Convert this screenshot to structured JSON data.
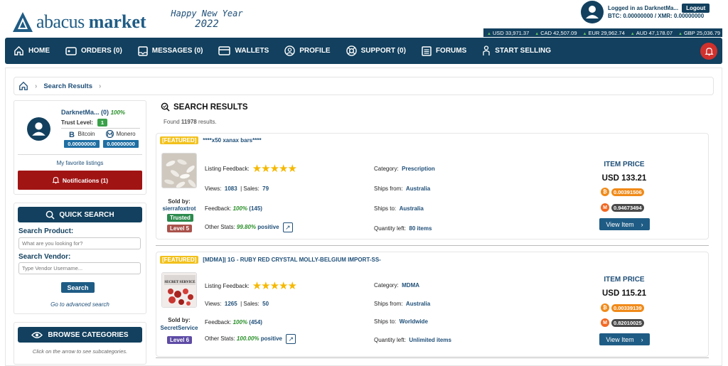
{
  "header": {
    "logo_word1": "abacus",
    "logo_word2": "market",
    "greeting_line1": "Happy New Year",
    "greeting_line2": "2022",
    "login_text": "Logged in as DarknetMa...",
    "logout_label": "Logout",
    "balance_text": "BTC: 0.00000000 / XMR: 0.00000000",
    "rates": [
      "USD 33,971.37",
      "CAD 42,507.09",
      "EUR 29,962.74",
      "AUD 47,178.07",
      "GBP 25,036.79"
    ]
  },
  "nav": {
    "items": [
      {
        "label": "HOME",
        "icon": "home-icon"
      },
      {
        "label": "ORDERS (0)",
        "icon": "orders-icon"
      },
      {
        "label": "MESSAGES (0)",
        "icon": "messages-icon"
      },
      {
        "label": "WALLETS",
        "icon": "wallet-icon"
      },
      {
        "label": "PROFILE",
        "icon": "profile-icon"
      },
      {
        "label": "SUPPORT (0)",
        "icon": "support-icon"
      },
      {
        "label": "FORUMS",
        "icon": "forums-icon"
      },
      {
        "label": "START SELLING",
        "icon": "seller-icon"
      }
    ],
    "bell_icon": "bell-icon"
  },
  "breadcrumb": {
    "current": "Search Results"
  },
  "sidebar": {
    "profile": {
      "name": "DarknetMa...",
      "count": "(0)",
      "pct": "100%",
      "trust_label": "Trust Level:",
      "trust_value": "1",
      "btc_label": "Bitcoin",
      "btc_value": "0.00000000",
      "xmr_label": "Monero",
      "xmr_value": "0.00000000",
      "favorites": "My favorite listings",
      "notifications": "Notifications (1)"
    },
    "quick_search": {
      "title": "QUICK SEARCH",
      "product_label": "Search Product:",
      "product_placeholder": "What are you looking for?",
      "vendor_label": "Search Vendor:",
      "vendor_placeholder": "Type Vendor Username...",
      "search_btn": "Search",
      "advanced": "Go to advanced search"
    },
    "browse": {
      "title": "BROWSE CATEGORIES",
      "hint": "Click on the arrow to see subcategories."
    }
  },
  "results": {
    "title": "SEARCH RESULTS",
    "found_prefix": "Found",
    "found_count": "11978",
    "found_suffix": "results.",
    "listings": [
      {
        "featured": "[FEATURED]",
        "title": "****x50 xanax bars****",
        "feedback_label": "Listing Feedback:",
        "stars": "★★★★★",
        "views_label": "Views:",
        "views": "1083",
        "sales_label": "| Sales:",
        "sales": "79",
        "feedback2_label": "Feedback:",
        "feedback_pct": "100%",
        "feedback_count": "(145)",
        "other_label": "Other Stats:",
        "other_pct": "99.80%",
        "other_word": "positive",
        "category_label": "Category:",
        "category": "Prescription",
        "ships_from_label": "Ships from:",
        "ships_from": "Australia",
        "ships_to_label": "Ships to:",
        "ships_to": "Australia",
        "qty_label": "Quantity left:",
        "qty": "80 items",
        "sold_by": "Sold by:",
        "vendor": "sierrafoxtrot",
        "badges": [
          "Trusted",
          "Level 5"
        ],
        "price_label": "ITEM PRICE",
        "price_usd": "USD 133.21",
        "price_btc": "0.00391506",
        "price_xmr": "0.94673494",
        "view_label": "View Item"
      },
      {
        "featured": "[FEATURED]",
        "title": "[MDMA]| 1G - RUBY RED CRYSTAL MOLLY-BELGIUM IMPORT-SS-",
        "feedback_label": "Listing Feedback:",
        "stars": "★★★★★",
        "views_label": "Views:",
        "views": "1265",
        "sales_label": "| Sales:",
        "sales": "50",
        "feedback2_label": "Feedback:",
        "feedback_pct": "100%",
        "feedback_count": "(454)",
        "other_label": "Other Stats:",
        "other_pct": "100.00%",
        "other_word": "positive",
        "category_label": "Category:",
        "category": "MDMA",
        "ships_from_label": "Ships from:",
        "ships_from": "Australia",
        "ships_to_label": "Ships to:",
        "ships_to": "Worldwide",
        "qty_label": "Quantity left:",
        "qty": "Unlimited items",
        "sold_by": "Sold by:",
        "vendor": "SecretService",
        "badges": [
          "Level 6"
        ],
        "thumb_text": "SECRET SERVICE",
        "price_label": "ITEM PRICE",
        "price_usd": "USD 115.21",
        "price_btc": "0.00339139",
        "price_xmr": "0.82010025",
        "view_label": "View Item"
      }
    ]
  },
  "colors": {
    "navy": "#12405e",
    "accent_blue": "#1f5c85",
    "notification_red": "#a11414",
    "featured_yellow": "#f2c11b",
    "btc_orange": "#f08a19"
  }
}
